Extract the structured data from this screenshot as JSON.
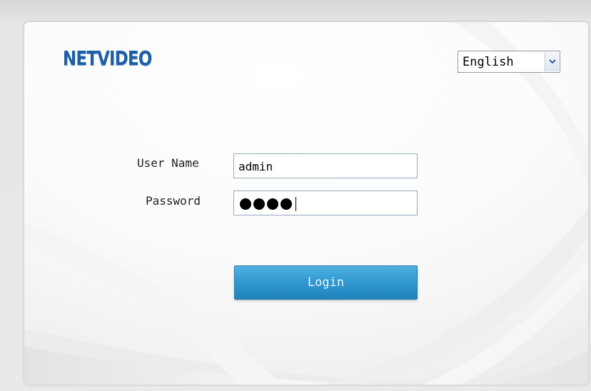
{
  "brand": {
    "logo_text": "NETVIDEO",
    "color": "#1f5fa6"
  },
  "language": {
    "selected": "English",
    "icon": "chevron-down-icon"
  },
  "form": {
    "username_label": "User Name",
    "username_value": "admin",
    "password_label": "Password",
    "password_masked_count": 4
  },
  "buttons": {
    "login_label": "Login",
    "login_color": "#2f97cf"
  }
}
